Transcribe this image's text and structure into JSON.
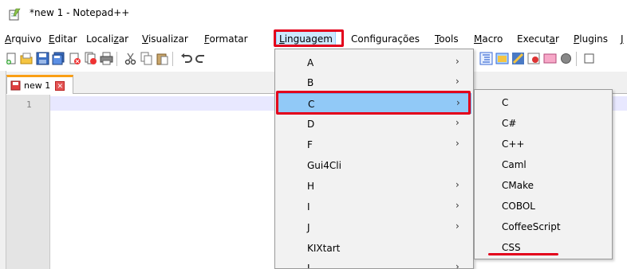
{
  "window": {
    "title": "*new 1 - Notepad++"
  },
  "menubar": {
    "items": [
      {
        "label": "Arquivo",
        "ul": "A",
        "rest": "rquivo"
      },
      {
        "label": "Editar",
        "ul": "E",
        "rest": "ditar"
      },
      {
        "label": "Localizar",
        "pre": "Locali",
        "ul": "z",
        "rest": "ar"
      },
      {
        "label": "Visualizar",
        "ul": "V",
        "rest": "isualizar"
      },
      {
        "label": "Formatar",
        "ul": "F",
        "rest": "ormatar"
      },
      {
        "label": "Linguagem",
        "ul": "L",
        "rest": "inguagem"
      },
      {
        "label": "Configurações",
        "pre": "",
        "ul": "",
        "rest": "Configurações"
      },
      {
        "label": "Tools",
        "ul": "T",
        "rest": "ools"
      },
      {
        "label": "Macro",
        "ul": "M",
        "rest": "acro"
      },
      {
        "label": "Executar",
        "pre": "Execut",
        "ul": "a",
        "rest": "r"
      },
      {
        "label": "Plugins",
        "ul": "P",
        "rest": "lugins"
      },
      {
        "label": "J",
        "ul": "J",
        "rest": ""
      }
    ]
  },
  "tab": {
    "label": "new 1",
    "close_glyph": "✕"
  },
  "editor": {
    "line_number": "1"
  },
  "language_menu": {
    "items": [
      {
        "label": "A",
        "has_submenu": true
      },
      {
        "label": "B",
        "has_submenu": true
      },
      {
        "label": "C",
        "has_submenu": true,
        "selected": true
      },
      {
        "label": "D",
        "has_submenu": true
      },
      {
        "label": "F",
        "has_submenu": true
      },
      {
        "label": "Gui4Cli",
        "has_submenu": false
      },
      {
        "label": "H",
        "has_submenu": true
      },
      {
        "label": "I",
        "has_submenu": true
      },
      {
        "label": "J",
        "has_submenu": true
      },
      {
        "label": "KIXtart",
        "has_submenu": false
      },
      {
        "label": "L",
        "has_submenu": true
      }
    ],
    "arrow_glyph": "›"
  },
  "c_submenu": {
    "items": [
      "C",
      "C#",
      "C++",
      "Caml",
      "CMake",
      "COBOL",
      "CoffeeScript",
      "CSS"
    ]
  },
  "colors": {
    "highlight": "#91c9f7",
    "annotation_red": "#e3001b",
    "tab_accent": "#fa9f15"
  }
}
